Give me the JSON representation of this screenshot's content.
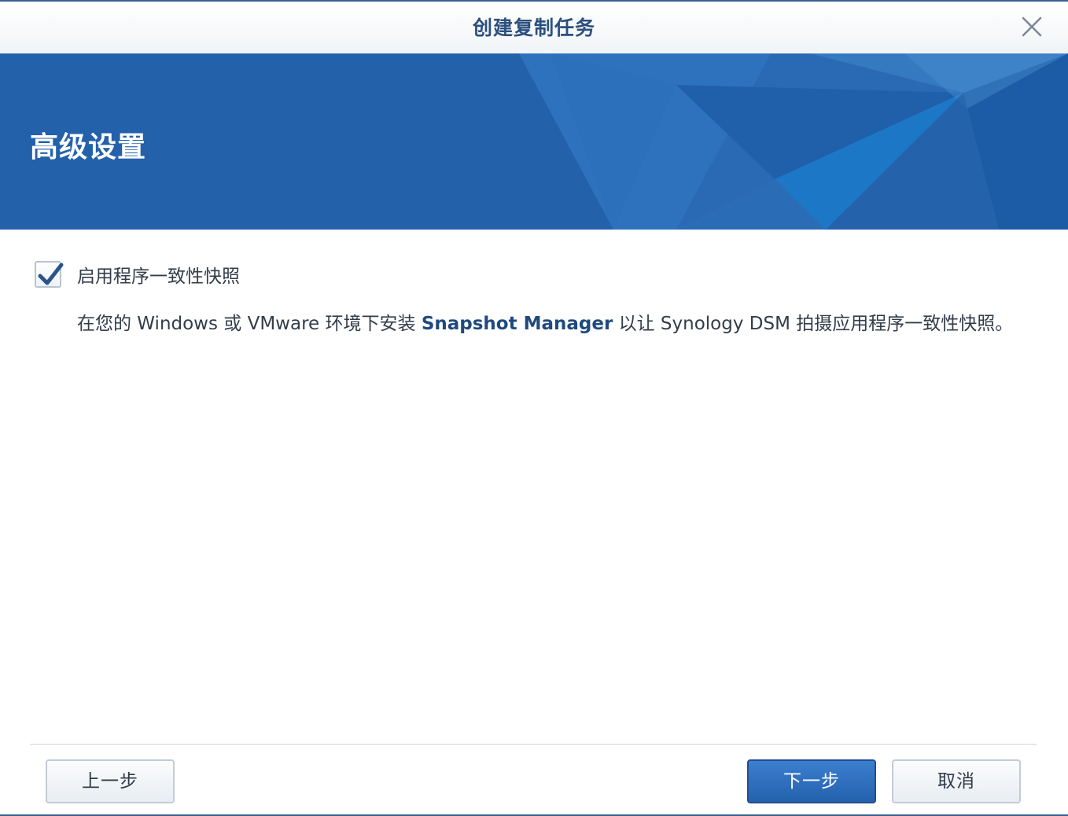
{
  "window": {
    "title": "创建复制任务"
  },
  "banner": {
    "title": "高级设置"
  },
  "options": {
    "app_consistent_snapshot": {
      "label": "启用程序一致性快照",
      "checked": true
    }
  },
  "description": {
    "part1": "在您的 Windows 或 VMware 环境下安装 ",
    "highlight": "Snapshot Manager",
    "part2": " 以让 Synology DSM 拍摄应用程序一致性快照。"
  },
  "footer": {
    "prev_label": "上一步",
    "next_label": "下一步",
    "cancel_label": "取消"
  },
  "colors": {
    "accent": "#2461ab",
    "title": "#2b4f7e",
    "check": "#2b5488"
  }
}
